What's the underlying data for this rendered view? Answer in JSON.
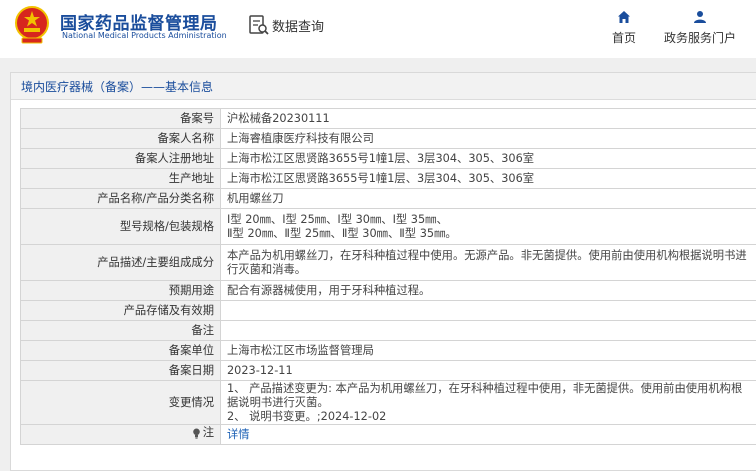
{
  "header": {
    "org_name_cn": "国家药品监督管理局",
    "org_name_en": "National Medical Products Administration",
    "query_label": "数据查询",
    "nav": [
      {
        "label": "首页",
        "icon": "home-icon"
      },
      {
        "label": "政务服务门户",
        "icon": "user-icon"
      }
    ]
  },
  "panel": {
    "title": "境内医疗器械（备案）——基本信息"
  },
  "record": {
    "rows": [
      {
        "key": "备案号",
        "value": "沪松械备20230111"
      },
      {
        "key": "备案人名称",
        "value": "上海睿植康医疗科技有限公司"
      },
      {
        "key": "备案人注册地址",
        "value": "上海市松江区思贤路3655号1幢1层、3层304、305、306室"
      },
      {
        "key": "生产地址",
        "value": "上海市松江区思贤路3655号1幢1层、3层304、305、306室"
      },
      {
        "key": "产品名称/产品分类名称",
        "value": "机用螺丝刀"
      },
      {
        "key": "型号规格/包装规格",
        "value_lines": [
          "Ⅰ型 20㎜、Ⅰ型 25㎜、Ⅰ型 30㎜、Ⅰ型 35㎜、",
          "Ⅱ型 20㎜、Ⅱ型 25㎜、Ⅱ型 30㎜、Ⅱ型 35㎜。"
        ]
      },
      {
        "key": "产品描述/主要组成成分",
        "value": "本产品为机用螺丝刀，在牙科种植过程中使用。无源产品。非无菌提供。使用前由使用机构根据说明书进行灭菌和消毒。"
      },
      {
        "key": "预期用途",
        "value": "配合有源器械使用，用于牙科种植过程。"
      },
      {
        "key": "产品存储及有效期",
        "value": ""
      },
      {
        "key": "备注",
        "value": ""
      },
      {
        "key": "备案单位",
        "value": "上海市松江区市场监督管理局"
      },
      {
        "key": "备案日期",
        "value": "2023-12-11"
      },
      {
        "key": "变更情况",
        "value_lines": [
          "1、 产品描述变更为: 本产品为机用螺丝刀，在牙科种植过程中使用，非无菌提供。使用前由使用机构根据说明书进行灭菌。",
          "2、 说明书变更。;2024-12-02"
        ]
      },
      {
        "key": "注",
        "value": "详情"
      }
    ]
  },
  "colors": {
    "brand_blue": "#1a4d9c",
    "link_blue": "#1a5fb4",
    "emblem_red": "#d7261e",
    "emblem_gold": "#f2c200"
  }
}
